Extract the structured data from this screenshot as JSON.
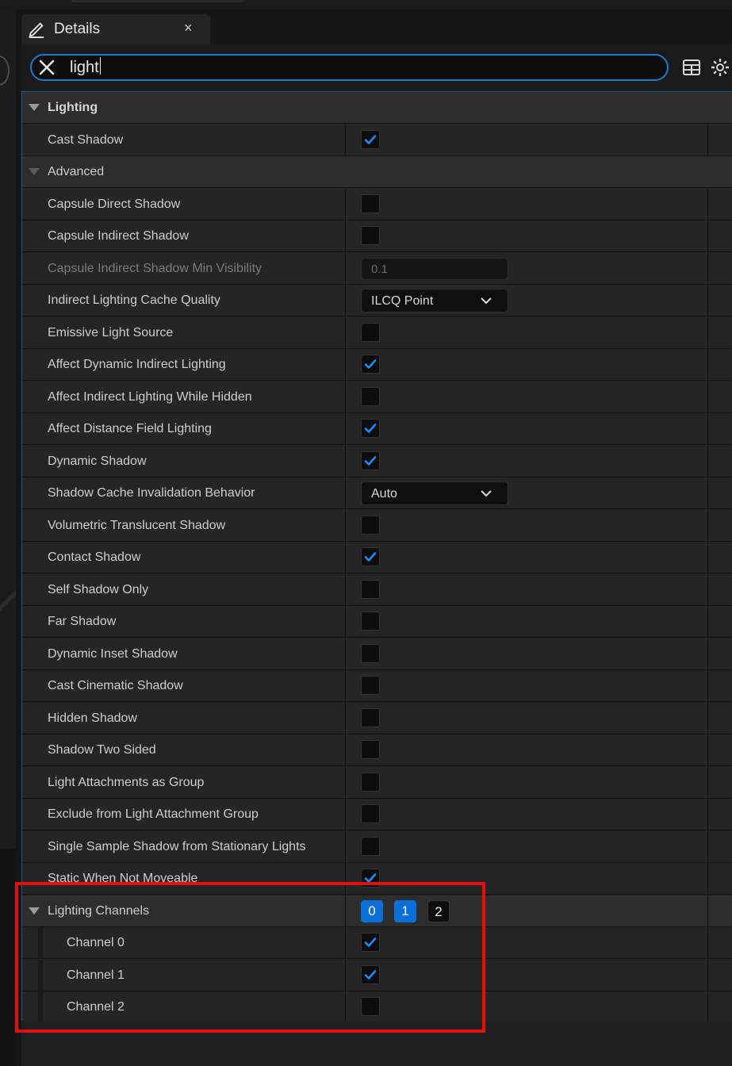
{
  "tab": {
    "title": "Details",
    "close": "×"
  },
  "search": {
    "value": "light"
  },
  "rows": [
    {
      "name": "Lighting",
      "type": "header",
      "bold": true
    },
    {
      "name": "Cast Shadow",
      "type": "checkbox",
      "checked": true
    },
    {
      "name": "Advanced",
      "type": "header",
      "bold": false
    },
    {
      "name": "Capsule Direct Shadow",
      "type": "checkbox",
      "checked": false
    },
    {
      "name": "Capsule Indirect Shadow",
      "type": "checkbox",
      "checked": false
    },
    {
      "name": "Capsule Indirect Shadow Min Visibility",
      "type": "number",
      "value": "0.1",
      "disabled": true
    },
    {
      "name": "Indirect Lighting Cache Quality",
      "type": "combo",
      "value": "ILCQ Point"
    },
    {
      "name": "Emissive Light Source",
      "type": "checkbox",
      "checked": false
    },
    {
      "name": "Affect Dynamic Indirect Lighting",
      "type": "checkbox",
      "checked": true
    },
    {
      "name": "Affect Indirect Lighting While Hidden",
      "type": "checkbox",
      "checked": false
    },
    {
      "name": "Affect Distance Field Lighting",
      "type": "checkbox",
      "checked": true
    },
    {
      "name": "Dynamic Shadow",
      "type": "checkbox",
      "checked": true
    },
    {
      "name": "Shadow Cache Invalidation Behavior",
      "type": "combo",
      "value": "Auto"
    },
    {
      "name": "Volumetric Translucent Shadow",
      "type": "checkbox",
      "checked": false
    },
    {
      "name": "Contact Shadow",
      "type": "checkbox",
      "checked": true
    },
    {
      "name": "Self Shadow Only",
      "type": "checkbox",
      "checked": false
    },
    {
      "name": "Far Shadow",
      "type": "checkbox",
      "checked": false
    },
    {
      "name": "Dynamic Inset Shadow",
      "type": "checkbox",
      "checked": false
    },
    {
      "name": "Cast Cinematic Shadow",
      "type": "checkbox",
      "checked": false
    },
    {
      "name": "Hidden Shadow",
      "type": "checkbox",
      "checked": false
    },
    {
      "name": "Shadow Two Sided",
      "type": "checkbox",
      "checked": false
    },
    {
      "name": "Light Attachments as Group",
      "type": "checkbox",
      "checked": false
    },
    {
      "name": "Exclude from Light Attachment Group",
      "type": "checkbox",
      "checked": false
    },
    {
      "name": "Single Sample Shadow from Stationary Lights",
      "type": "checkbox",
      "checked": false
    },
    {
      "name": "Static When Not Moveable",
      "type": "checkbox",
      "checked": true
    },
    {
      "name": "Lighting Channels",
      "type": "channels",
      "channels": [
        {
          "label": "0",
          "on": true
        },
        {
          "label": "1",
          "on": true
        },
        {
          "label": "2",
          "on": false
        }
      ]
    },
    {
      "name": "Channel 0",
      "type": "checkbox",
      "checked": true,
      "child": true
    },
    {
      "name": "Channel 1",
      "type": "checkbox",
      "checked": true,
      "child": true
    },
    {
      "name": "Channel 2",
      "type": "checkbox",
      "checked": false,
      "child": true
    }
  ],
  "colors": {
    "accent": "#1f77d0",
    "check": "#1a8cff",
    "highlight": "#e01010"
  },
  "icons": [
    "pencil-icon",
    "close-icon",
    "clear-search-icon",
    "table-view-icon",
    "settings-gear-icon",
    "chevron-down-icon",
    "expand-arrow-icon",
    "checkmark-icon"
  ]
}
